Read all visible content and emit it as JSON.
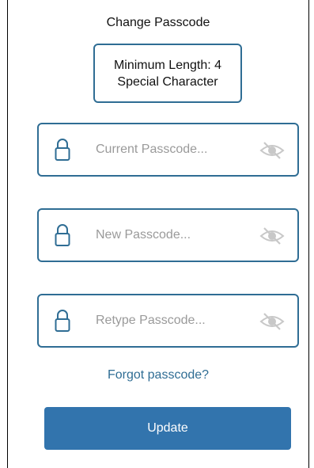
{
  "header": {
    "title": "Change Passcode"
  },
  "requirements": {
    "line1": "Minimum Length: 4",
    "line2": "Special Character"
  },
  "fields": {
    "current": {
      "placeholder": "Current Passcode...",
      "value": ""
    },
    "new": {
      "placeholder": "New Passcode...",
      "value": ""
    },
    "retype": {
      "placeholder": "Retype Passcode...",
      "value": ""
    }
  },
  "links": {
    "forgot": "Forgot passcode?"
  },
  "actions": {
    "update_label": "Update"
  },
  "colors": {
    "accent": "#2f6d94",
    "button": "#3274ad",
    "placeholder": "#9a9a9a",
    "eye_icon": "#c8c8c8"
  },
  "icons": {
    "field_leading": "lock-icon",
    "field_trailing": "eye-off-icon"
  }
}
